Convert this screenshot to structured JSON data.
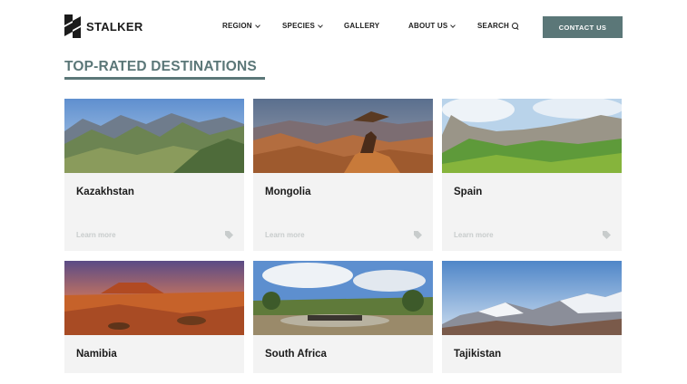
{
  "brand": {
    "name": "STALKER"
  },
  "nav": {
    "items": [
      {
        "label": "REGION",
        "has_dropdown": true
      },
      {
        "label": "SPECIES",
        "has_dropdown": true
      },
      {
        "label": "GALLERY",
        "has_dropdown": false
      },
      {
        "label": "ABOUT US",
        "has_dropdown": true
      }
    ],
    "search_label": "SEARCH",
    "contact_label": "CONTACT US"
  },
  "section": {
    "title": "TOP-RATED DESTINATIONS"
  },
  "destinations": [
    {
      "name": "Kazakhstan",
      "link_label": "Learn more",
      "image": "mountain-valley-landscape"
    },
    {
      "name": "Mongolia",
      "link_label": "Learn more",
      "image": "eagle-on-rocks-desert"
    },
    {
      "name": "Spain",
      "link_label": "Learn more",
      "image": "limestone-cliffs-green-meadow"
    },
    {
      "name": "Namibia",
      "link_label": "",
      "image": "red-desert-sunset-mesa"
    },
    {
      "name": "South Africa",
      "link_label": "",
      "image": "wildlife-at-waterhole"
    },
    {
      "name": "Tajikistan",
      "link_label": "",
      "image": "snowy-mountain-range"
    }
  ],
  "colors": {
    "accent": "#5b7778",
    "card_bg": "#f3f3f3",
    "link_muted": "#c8cccc"
  }
}
